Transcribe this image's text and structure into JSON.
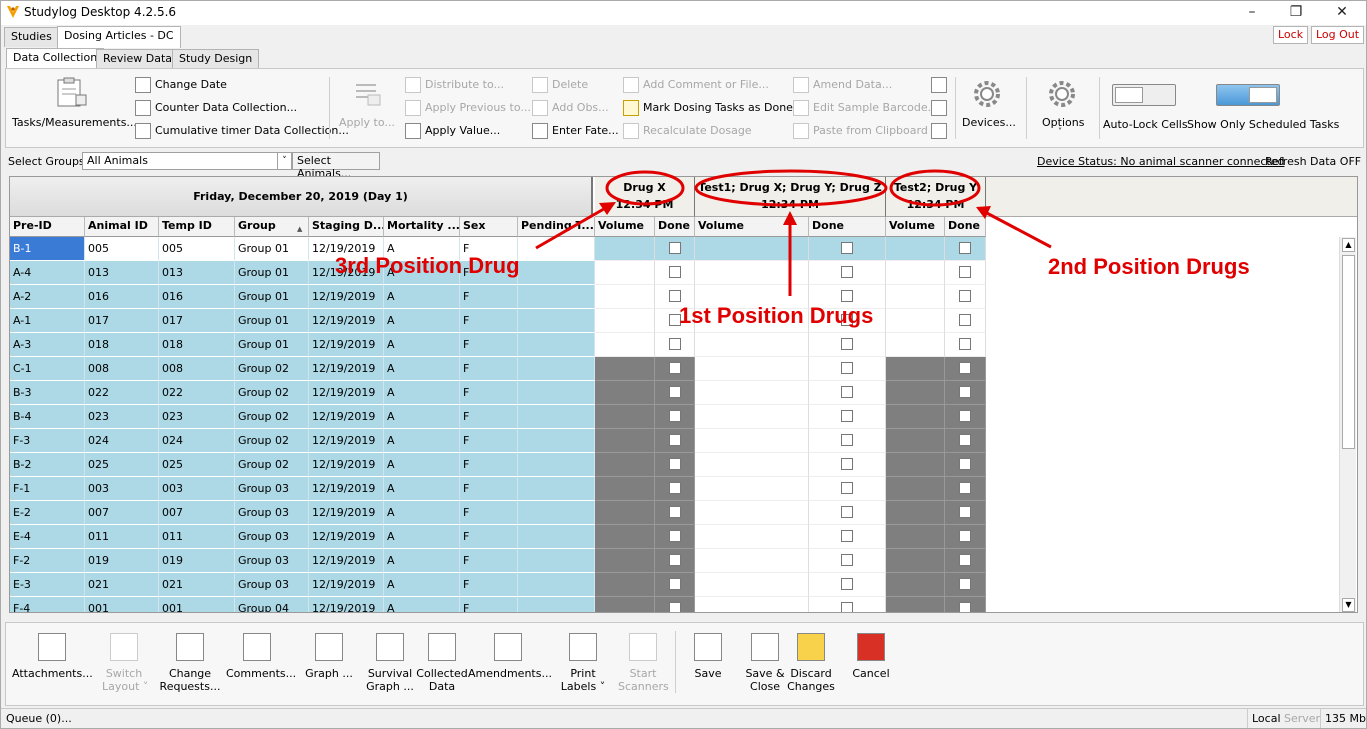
{
  "window": {
    "title": "Studylog Desktop 4.2.5.6",
    "minimize": "–",
    "restore": "❐",
    "close": "✕"
  },
  "top_tabs": [
    "Studies",
    "Dosing Articles - DC"
  ],
  "lock_label": "Lock",
  "logout_label": "Log Out",
  "sub_tabs": [
    "Data Collection",
    "Review Data",
    "Study Design"
  ],
  "ribbon": {
    "tasks": "Tasks/Measurements...",
    "change_date": "Change Date",
    "counter": "Counter Data Collection...",
    "cumulative": "Cumulative timer Data Collection...",
    "apply_to": "Apply to...",
    "distribute": "Distribute to...",
    "apply_prev": "Apply Previous to...",
    "apply_value": "Apply Value...",
    "delete": "Delete",
    "add_obs": "Add Obs...",
    "enter_fate": "Enter Fate...",
    "add_comment": "Add Comment or File...",
    "mark_dosing": "Mark Dosing Tasks as Done...",
    "recalc": "Recalculate Dosage",
    "amend": "Amend Data...",
    "edit_barcode": "Edit Sample Barcode...",
    "paste": "Paste from Clipboard",
    "devices": "Devices...",
    "options": "Options",
    "autolock": "Auto-Lock Cells",
    "show_scheduled": "Show Only Scheduled Tasks"
  },
  "groups_bar": {
    "label": "Select Groups:",
    "value": "All Animals",
    "select_animals": "Select Animals...",
    "device_status": "Device Status: No animal scanner connected",
    "refresh": "Refresh Data OFF"
  },
  "grid": {
    "date_header": "Friday, December 20, 2019 (Day 1)",
    "drug_cols": [
      {
        "name": "Drug X",
        "time": "12:34 PM"
      },
      {
        "name": "Test1; Drug X; Drug Y; Drug Z",
        "time": "12:34 PM"
      },
      {
        "name": "Test2; Drug Y",
        "time": "12:34 PM"
      }
    ],
    "columns": [
      "Pre-ID",
      "Animal ID",
      "Temp ID",
      "Group",
      "Staging D...",
      "Mortality ...",
      "Sex",
      "Pending T...",
      "Volume",
      "Done",
      "Volume",
      "Done",
      "Volume",
      "Done"
    ],
    "rows": [
      [
        "B-1",
        "005",
        "005",
        "Group 01",
        "12/19/2019",
        "A",
        "F"
      ],
      [
        "A-4",
        "013",
        "013",
        "Group 01",
        "12/19/2019",
        "A",
        "F"
      ],
      [
        "A-2",
        "016",
        "016",
        "Group 01",
        "12/19/2019",
        "A",
        "F"
      ],
      [
        "A-1",
        "017",
        "017",
        "Group 01",
        "12/19/2019",
        "A",
        "F"
      ],
      [
        "A-3",
        "018",
        "018",
        "Group 01",
        "12/19/2019",
        "A",
        "F"
      ],
      [
        "C-1",
        "008",
        "008",
        "Group 02",
        "12/19/2019",
        "A",
        "F"
      ],
      [
        "B-3",
        "022",
        "022",
        "Group 02",
        "12/19/2019",
        "A",
        "F"
      ],
      [
        "B-4",
        "023",
        "023",
        "Group 02",
        "12/19/2019",
        "A",
        "F"
      ],
      [
        "F-3",
        "024",
        "024",
        "Group 02",
        "12/19/2019",
        "A",
        "F"
      ],
      [
        "B-2",
        "025",
        "025",
        "Group 02",
        "12/19/2019",
        "A",
        "F"
      ],
      [
        "F-1",
        "003",
        "003",
        "Group 03",
        "12/19/2019",
        "A",
        "F"
      ],
      [
        "E-2",
        "007",
        "007",
        "Group 03",
        "12/19/2019",
        "A",
        "F"
      ],
      [
        "E-4",
        "011",
        "011",
        "Group 03",
        "12/19/2019",
        "A",
        "F"
      ],
      [
        "F-2",
        "019",
        "019",
        "Group 03",
        "12/19/2019",
        "A",
        "F"
      ],
      [
        "E-3",
        "021",
        "021",
        "Group 03",
        "12/19/2019",
        "A",
        "F"
      ],
      [
        "F-4",
        "001",
        "001",
        "Group 04",
        "12/19/2019",
        "A",
        "F"
      ]
    ]
  },
  "annotations": {
    "third": "3rd Position Drug",
    "first": "1st Position Drugs",
    "second": "2nd Position Drugs"
  },
  "bottom": {
    "attachments": "Attachments...",
    "switch_layout": "Switch\nLayout ˅",
    "change_requests": "Change\nRequests...",
    "comments": "Comments...",
    "graph": "Graph ...",
    "survival": "Survival\nGraph ...",
    "collected": "Collected\nData",
    "amendments": "Amendments...",
    "print_labels": "Print\nLabels ˅",
    "start_scanners": "Start\nScanners",
    "save": "Save",
    "save_close": "Save &\nClose",
    "discard": "Discard\nChanges",
    "cancel": "Cancel"
  },
  "status": {
    "queue": "Queue (0)...",
    "local": "Local",
    "server": "Server",
    "memory": "135 Mb"
  },
  "colors": {
    "row_blue": "#add8e6",
    "selected": "#3a7bd5",
    "gray_cell": "#7f7f7f",
    "annotation": "#e00000"
  }
}
